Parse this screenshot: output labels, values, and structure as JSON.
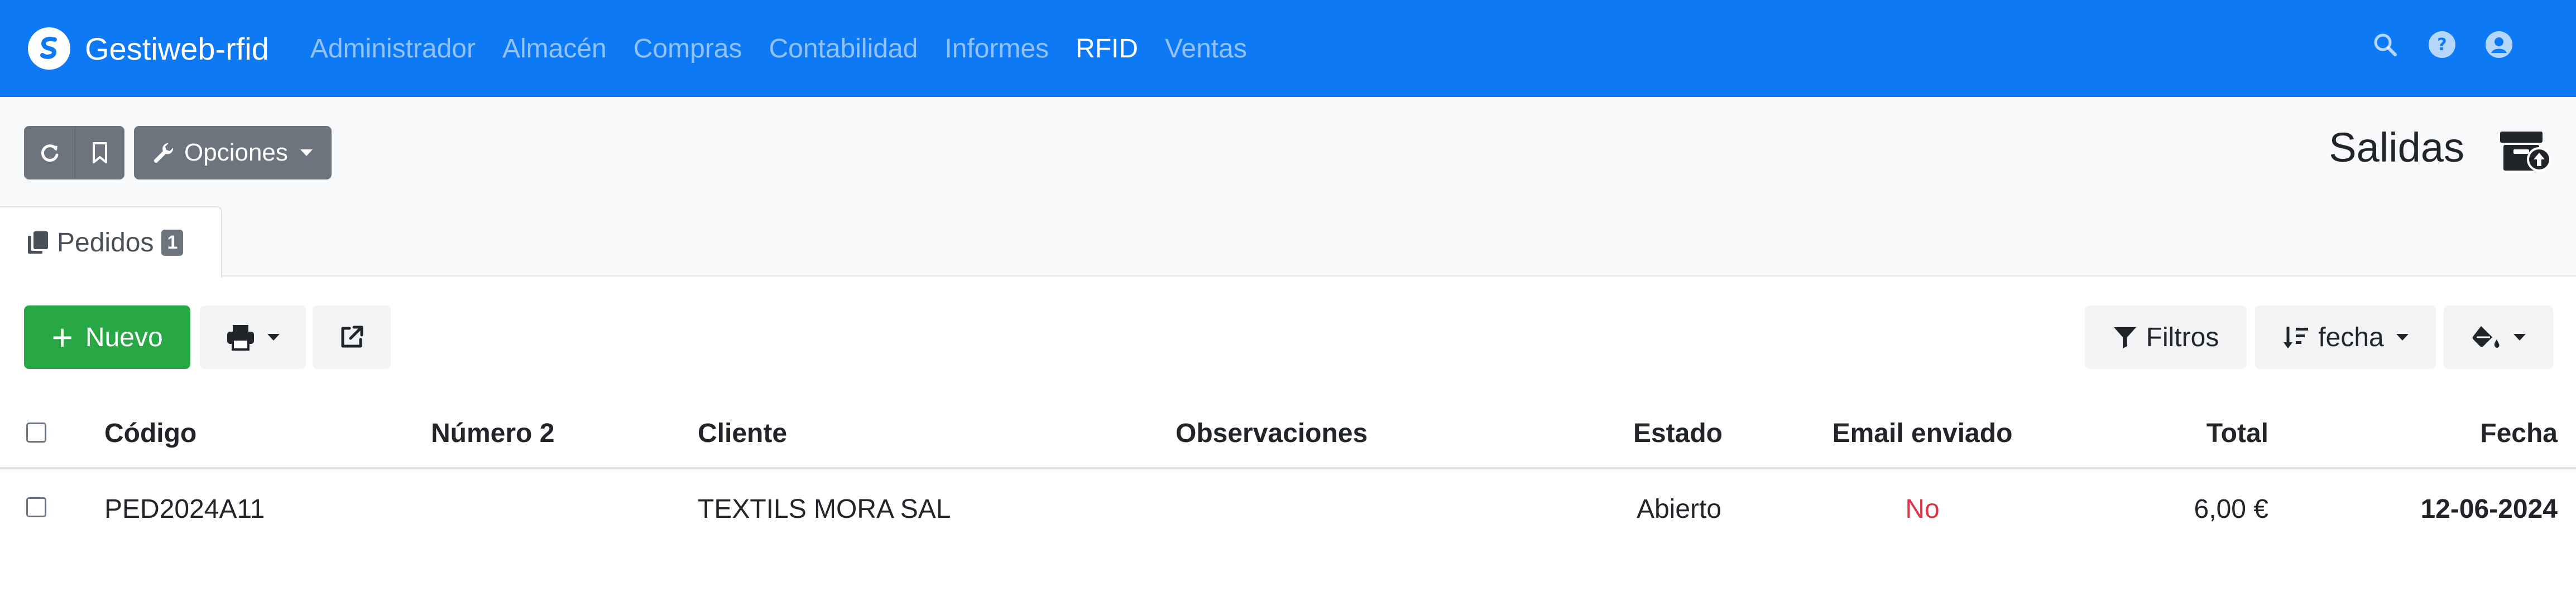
{
  "navbar": {
    "brand": "Gestiweb-rfid",
    "links": [
      {
        "label": "Administrador",
        "active": false
      },
      {
        "label": "Almacén",
        "active": false
      },
      {
        "label": "Compras",
        "active": false
      },
      {
        "label": "Contabilidad",
        "active": false
      },
      {
        "label": "Informes",
        "active": false
      },
      {
        "label": "RFID",
        "active": true
      },
      {
        "label": "Ventas",
        "active": false
      }
    ],
    "icons": [
      "search-icon",
      "help-icon",
      "user-icon"
    ]
  },
  "toolbar": {
    "options_label": "Opciones",
    "page_title": "Salidas"
  },
  "tab": {
    "label": "Pedidos",
    "count": "1"
  },
  "actions": {
    "new_label": "Nuevo",
    "filters_label": "Filtros",
    "sort_label": "fecha"
  },
  "table": {
    "headers": {
      "codigo": "Código",
      "numero2": "Número 2",
      "cliente": "Cliente",
      "observaciones": "Observaciones",
      "estado": "Estado",
      "email": "Email enviado",
      "total": "Total",
      "fecha": "Fecha"
    },
    "rows": [
      {
        "codigo": "PED2024A11",
        "numero2": "",
        "cliente": "TEXTILS MORA SAL",
        "observaciones": "",
        "estado": "Abierto",
        "email": "No",
        "total": "6,00 €",
        "fecha": "12-06-2024"
      }
    ]
  },
  "colors": {
    "navbar": "#0d79f5",
    "success": "#28a745",
    "secondary": "#6c757d",
    "danger": "#dc3545"
  }
}
